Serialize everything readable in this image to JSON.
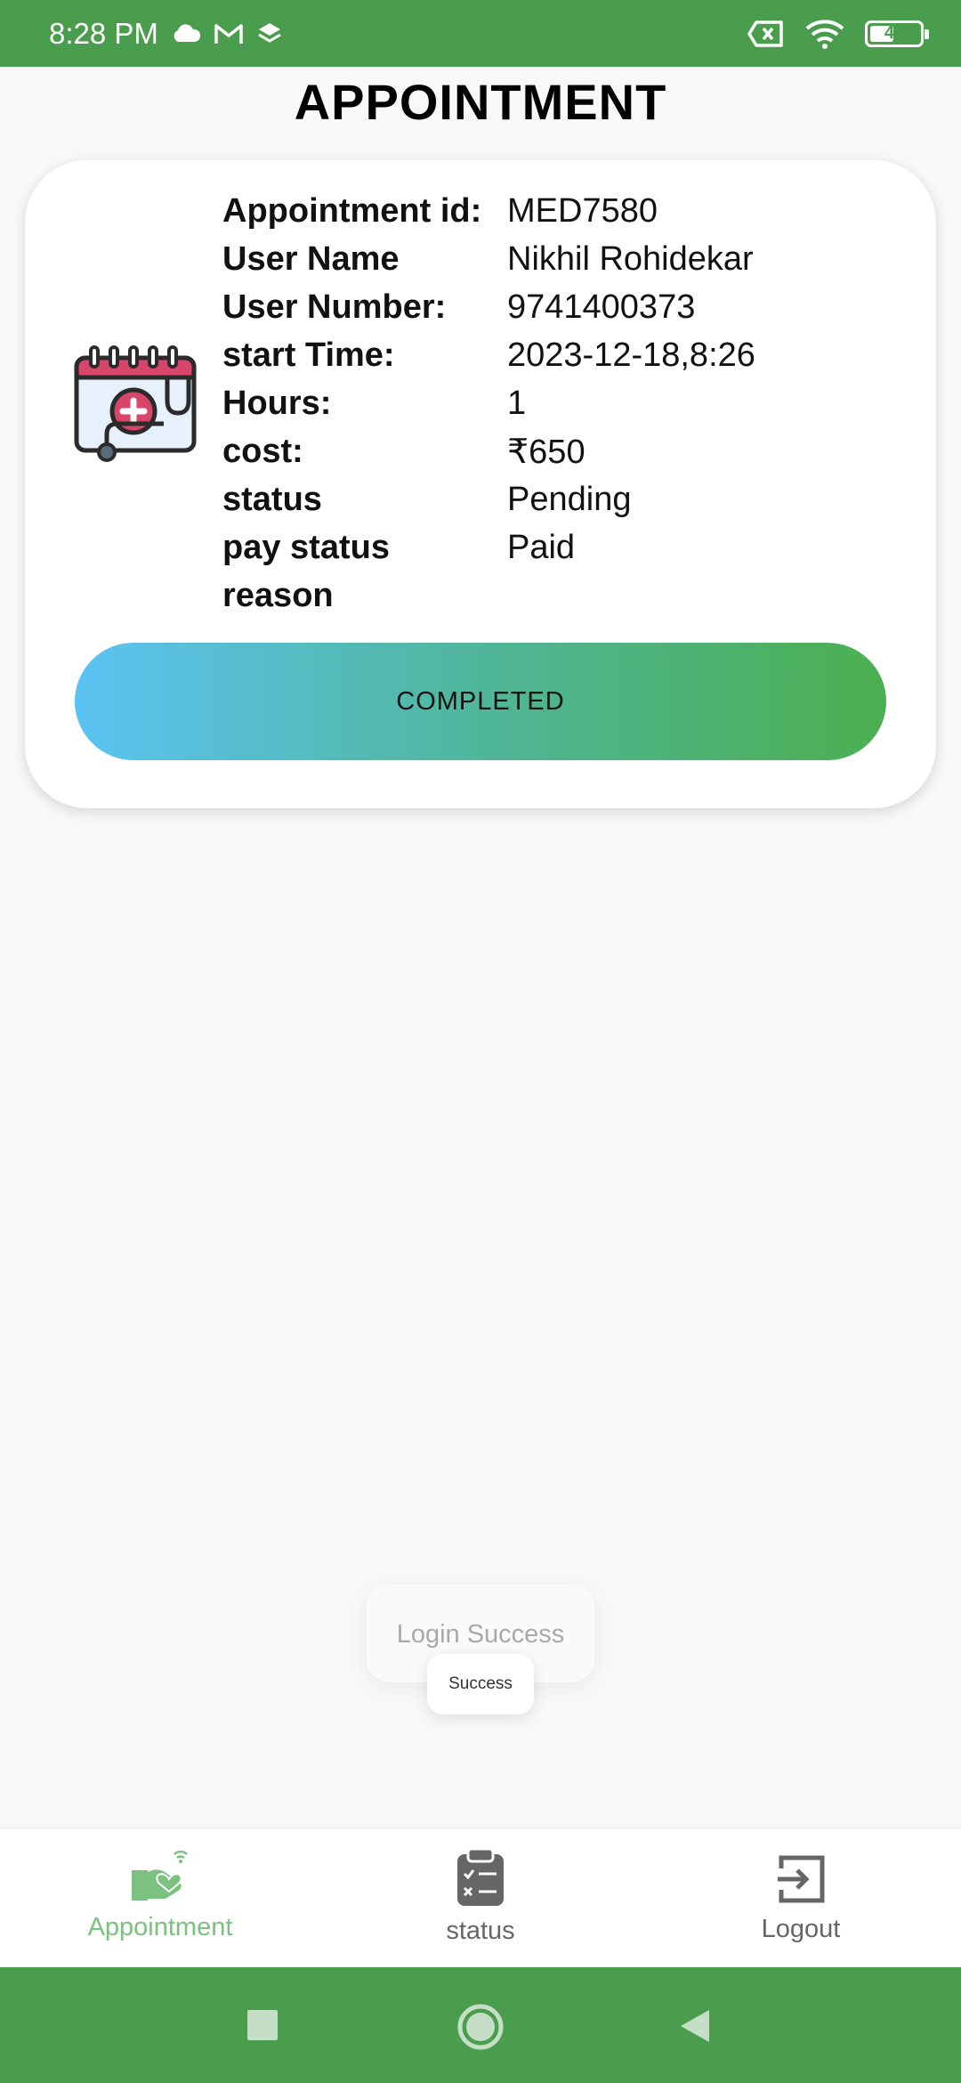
{
  "status_bar": {
    "time": "8:28 PM",
    "battery": "41",
    "icons": [
      "cloud-icon",
      "gmail-icon",
      "layers-icon",
      "sim-off-icon",
      "wifi-icon",
      "battery-icon"
    ]
  },
  "page": {
    "title": "APPOINTMENT"
  },
  "appointment": {
    "icon": "medical-calendar-icon",
    "rows": [
      {
        "label": "Appointment id:",
        "value": "MED7580"
      },
      {
        "label": "User Name",
        "value": "Nikhil Rohidekar"
      },
      {
        "label": "User Number:",
        "value": "9741400373"
      },
      {
        "label": "start Time:",
        "value": "2023-12-18,8:26"
      },
      {
        "label": "Hours:",
        "value": "1"
      },
      {
        "label": "cost:",
        "value": "₹650"
      },
      {
        "label": "status",
        "value": "Pending"
      },
      {
        "label": "pay status",
        "value": "Paid"
      },
      {
        "label": "reason",
        "value": ""
      }
    ],
    "button_label": "COMPLETED"
  },
  "toasts": {
    "primary": "Login Success",
    "secondary": "Success"
  },
  "bottom_nav": {
    "items": [
      {
        "label": "Appointment",
        "icon": "heart-hand-icon",
        "active": true
      },
      {
        "label": "status",
        "icon": "clipboard-checklist-icon",
        "active": false
      },
      {
        "label": "Logout",
        "icon": "logout-icon",
        "active": false
      }
    ]
  },
  "colors": {
    "status_bar": "#4b9d4e",
    "active_nav": "#7cc17f",
    "button_gradient_start": "#5bc3f3",
    "button_gradient_end": "#4caf50"
  }
}
